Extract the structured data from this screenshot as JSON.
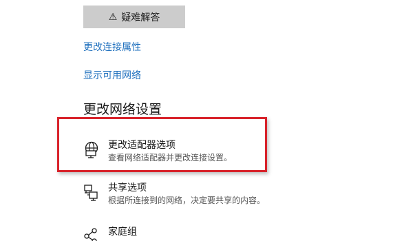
{
  "troubleshoot": {
    "icon": "warning-icon",
    "label": "疑难解答"
  },
  "links": {
    "change_connection_properties": "更改连接属性",
    "show_available_networks": "显示可用网络"
  },
  "section": {
    "title": "更改网络设置"
  },
  "options": [
    {
      "icon": "network-adapter-icon",
      "title": "更改适配器选项",
      "description": "查看网络适配器并更改连接设置。"
    },
    {
      "icon": "sharing-icon",
      "title": "共享选项",
      "description": "根据所连接到的网络，决定要共享的内容。"
    },
    {
      "icon": "homegroup-icon",
      "title": "家庭组",
      "description": ""
    }
  ],
  "colors": {
    "link": "#1e6fbd",
    "highlight": "#d8222a",
    "button_bg": "#cccccc"
  }
}
